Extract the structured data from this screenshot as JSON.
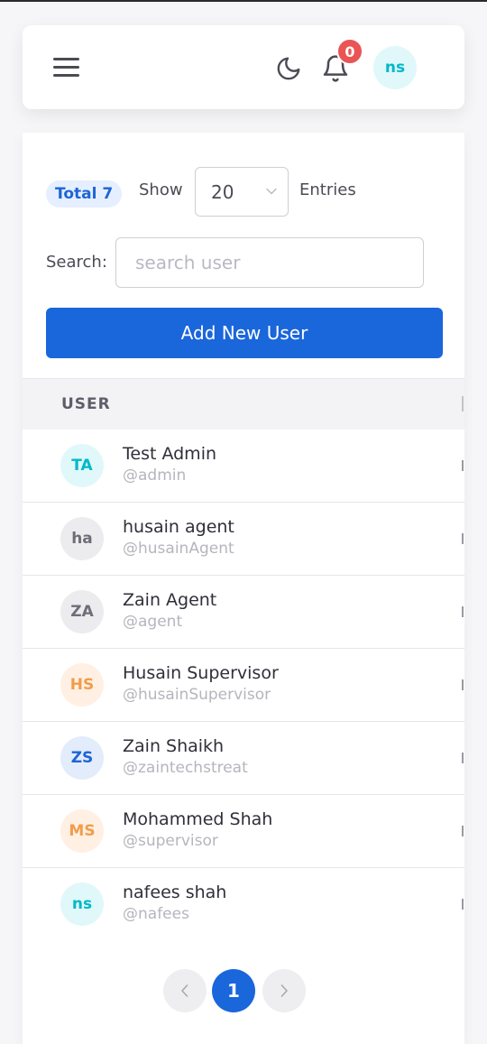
{
  "header": {
    "notification_count": "0",
    "user_initials": "ns",
    "icons": [
      "menu-icon",
      "moon-icon",
      "bell-icon"
    ]
  },
  "toolbar": {
    "total_label": "Total 7",
    "show_label": "Show",
    "entries_value": "20",
    "entries_label": "Entries",
    "search_label": "Search:",
    "search_placeholder": "search user",
    "search_value": "",
    "add_button_label": "Add New User"
  },
  "table": {
    "column_user": "USER",
    "rows": [
      {
        "initials": "TA",
        "name": "Test Admin",
        "handle": "@admin"
      },
      {
        "initials": "ha",
        "name": "husain agent",
        "handle": "@husainAgent"
      },
      {
        "initials": "ZA",
        "name": "Zain Agent",
        "handle": "@agent"
      },
      {
        "initials": "HS",
        "name": "Husain Supervisor",
        "handle": "@husainSupervisor"
      },
      {
        "initials": "ZS",
        "name": "Zain Shaikh",
        "handle": "@zaintechstreat"
      },
      {
        "initials": "MS",
        "name": "Mohammed Shah",
        "handle": "@supervisor"
      },
      {
        "initials": "ns",
        "name": "nafees shah",
        "handle": "@nafees"
      }
    ]
  },
  "pagination": {
    "current_page": "1"
  },
  "colors": {
    "primary": "#1a66db",
    "badge_red": "#ea5455",
    "avatar_cyan": "#00b8c9",
    "avatar_gray": "#6e6e78",
    "avatar_orange": "#f39c4a",
    "avatar_blue": "#1e64d6"
  }
}
